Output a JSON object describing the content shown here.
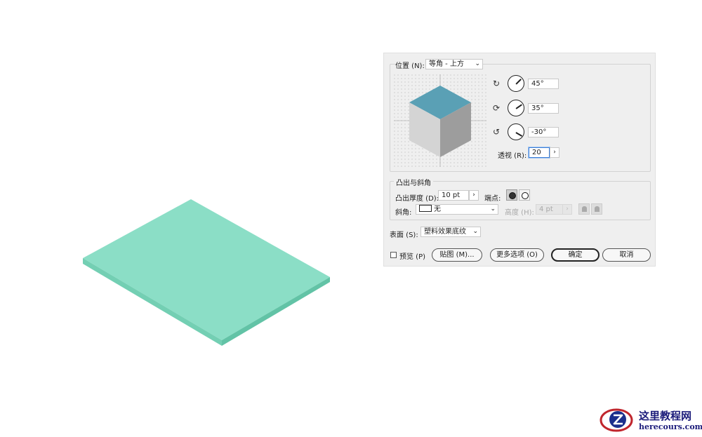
{
  "dialog": {
    "position_label": "位置 (N):",
    "position_value": "等角 - 上方",
    "rotations": [
      {
        "icon": "rotate-x-icon",
        "value": "45°"
      },
      {
        "icon": "rotate-y-icon",
        "value": "35°"
      },
      {
        "icon": "rotate-z-icon",
        "value": "-30°"
      }
    ],
    "perspective_label": "透视 (R):",
    "perspective_value": "20",
    "extrude_group_title": "凸出与斜角",
    "extrude_depth_label": "凸出厚度 (D):",
    "extrude_depth_value": "10 pt",
    "cap_label": "端点:",
    "bevel_label": "斜角:",
    "bevel_value": "无",
    "height_label": "高度 (H):",
    "height_value": "4 pt",
    "surface_label": "表面 (S):",
    "surface_value": "塑料效果底纹",
    "preview_label": "预览 (P)",
    "map_button": "贴图 (M)...",
    "more_options_button": "更多选项 (O)",
    "ok_button": "确定",
    "cancel_button": "取消"
  },
  "canvas": {
    "slab_top_color": "#8bdec6",
    "slab_side_color": "#6bc8ab"
  },
  "watermark": {
    "title": "这里教程网",
    "url": "herecours.com"
  }
}
